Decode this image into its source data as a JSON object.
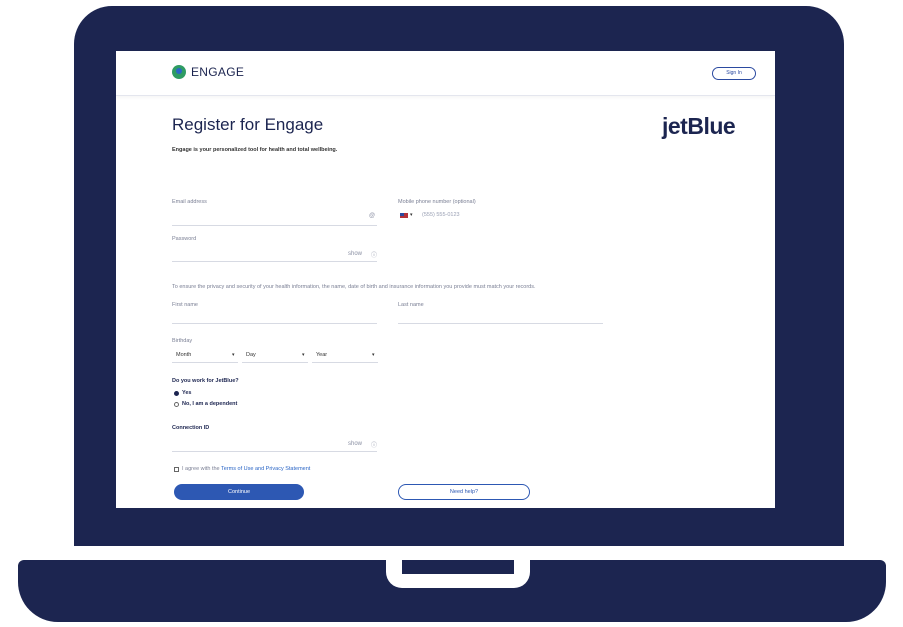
{
  "header": {
    "brand_name": "ENGAGE",
    "sign_in_label": "Sign In"
  },
  "page": {
    "title": "Register for Engage",
    "subtitle": "Engage is your personalized tool for health and total wellbeing.",
    "partner_logo": "jetBlue"
  },
  "form": {
    "email_label": "Email address",
    "email_icon": "@",
    "phone_label": "Mobile phone number (optional)",
    "phone_country": "+1",
    "phone_placeholder": "(555) 555-0123",
    "password_label": "Password",
    "password_toggle": "show",
    "identity_notice": "To ensure the privacy and security of your health information, the name, date of birth and insurance information you provide must match your records.",
    "first_name_label": "First name",
    "last_name_label": "Last name",
    "birthday_label": "Birthday",
    "month_value": "Month",
    "day_value": "Day",
    "year_value": "Year",
    "work_question": "Do you work for JetBlue?",
    "option_yes": "Yes",
    "option_dependent": "No, I am a dependent",
    "connection_label": "Connection ID",
    "connection_toggle": "show",
    "terms_prefix": "I agree with the ",
    "terms_link": "Terms of Use and Privacy Statement",
    "continue_label": "Continue",
    "need_help_label": "Need help?"
  },
  "colors": {
    "laptop_frame": "#1c2550",
    "primary_button": "#2d58b3",
    "brand_green": "#2f9c63"
  }
}
